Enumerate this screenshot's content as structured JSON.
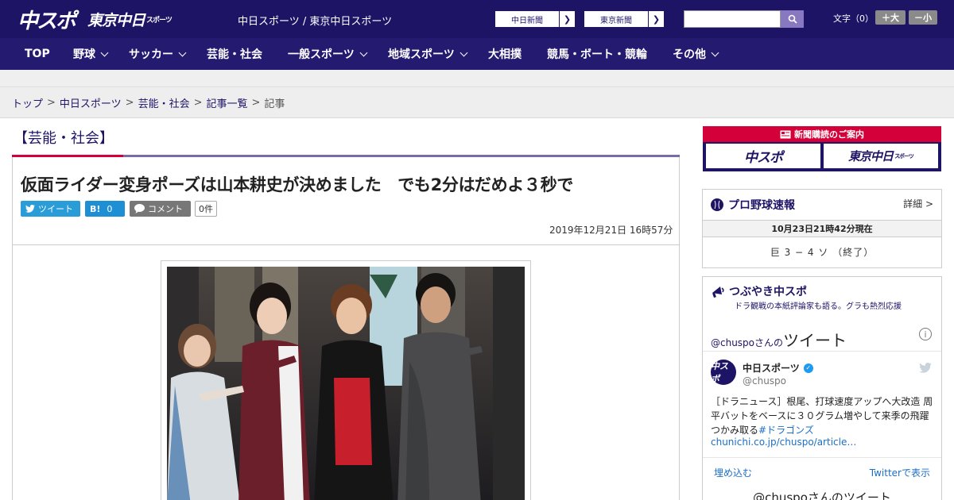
{
  "header": {
    "logo_chuspo": "中スポ",
    "logo_tokyo": "東京中日",
    "logo_tokyo_sub": "スポーツ",
    "site_title": "中日スポーツ / 東京中日スポーツ",
    "ext_link_1": "中日新聞",
    "ext_link_2": "東京新聞",
    "search_placeholder": "",
    "fontsize_label": "文字（0）",
    "fontsize_up": "＋大",
    "fontsize_down": "－小"
  },
  "nav": {
    "items": [
      "TOP",
      "野球",
      "サッカー",
      "芸能・社会",
      "一般スポーツ",
      "地域スポーツ",
      "大相撲",
      "競馬・ボート・競輪",
      "その他"
    ]
  },
  "breadcrumb": {
    "items": [
      "トップ",
      "中日スポーツ",
      "芸能・社会",
      "記事一覧",
      "記事"
    ],
    "separator": ">"
  },
  "article": {
    "category": "【芸能・社会】",
    "headline": "仮面ライダー変身ポーズは山本耕史が決めました　でも2分はだめよ３秒で",
    "share_tweet": "ツイート",
    "share_hatena": "B!",
    "hatena_count": "0",
    "share_comment": "コメント",
    "comment_count": "0件",
    "date": "2019年12月21日 16時57分"
  },
  "sidebar": {
    "subscription": {
      "header": "新聞購読のご案内",
      "logo1": "中スポ",
      "logo2": "東京中日",
      "logo2_sub": "スポーツ"
    },
    "baseball": {
      "title": "プロ野球速報",
      "more": "詳細 >",
      "time": "10月23日21時42分現在",
      "score": "巨 3 − 4 ソ （終了）"
    },
    "tweets": {
      "title": "つぶやき中スポ",
      "subtitle": "ドラ観戦の本紙評論家も語る。グラも熱烈応援",
      "handle_prefix": "@chuspoさんの",
      "handle_suffix": "ツイート",
      "info": "i",
      "account_name": "中日スポーツ",
      "avatar_text": "中スポ",
      "username": "@chuspo",
      "text": "［ドラニュース］根尾、打球速度アップへ大改造 周平バットをベースに３０グラム増やして来季の飛躍つかみ取る",
      "hashtag": "#ドラゴンズ",
      "link": "chunichi.co.jp/chuspo/article…",
      "embed": "埋め込む",
      "view_on_twitter": "Twitterで表示",
      "more_title": "@chuspoさんのツイート"
    }
  },
  "colors": {
    "brand_navy": "#1d1466",
    "accent_red": "#d3003a",
    "twitter_blue": "#2a9cd8"
  }
}
